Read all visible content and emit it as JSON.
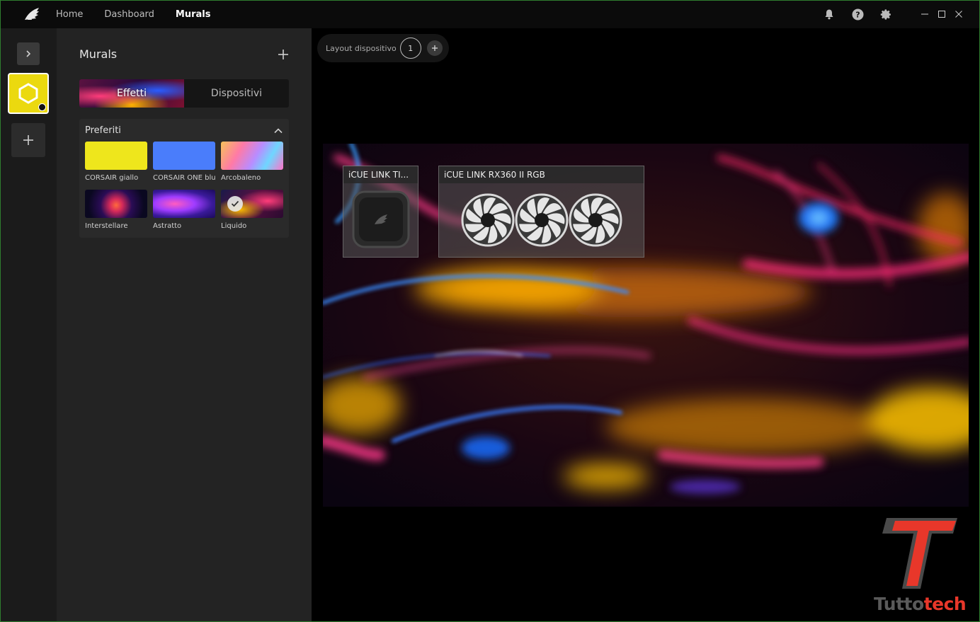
{
  "titlebar": {
    "nav": [
      {
        "label": "Home",
        "active": false
      },
      {
        "label": "Dashboard",
        "active": false
      },
      {
        "label": "Murals",
        "active": true
      }
    ],
    "icons": [
      "bell-icon",
      "help-icon",
      "gear-icon"
    ],
    "window_controls": [
      "minimize-icon",
      "maximize-icon",
      "close-icon"
    ]
  },
  "rail": {
    "mural_color": "#ebd90f"
  },
  "panel": {
    "title": "Murals",
    "tabs": [
      {
        "label": "Effetti",
        "active": true
      },
      {
        "label": "Dispositivi",
        "active": false
      }
    ],
    "favorites": {
      "title": "Preferiti",
      "items": [
        {
          "label": "CORSAIR giallo"
        },
        {
          "label": "CORSAIR ONE blu"
        },
        {
          "label": "Arcobaleno"
        },
        {
          "label": "Interstellare"
        },
        {
          "label": "Astratto"
        },
        {
          "label": "Liquido",
          "selected": true
        }
      ]
    }
  },
  "main": {
    "layout": {
      "label": "Layout dispositivo",
      "number": "1"
    },
    "devices": [
      {
        "title": "iCUE LINK TI..."
      },
      {
        "title": "iCUE LINK RX360 II RGB"
      }
    ]
  },
  "watermark": {
    "part1": "Tutto",
    "part2": "tech"
  },
  "colors": {
    "accent_yellow": "#ebd90f",
    "watermark_red": "#e8372a",
    "watermark_gray": "#5a5a5a"
  }
}
